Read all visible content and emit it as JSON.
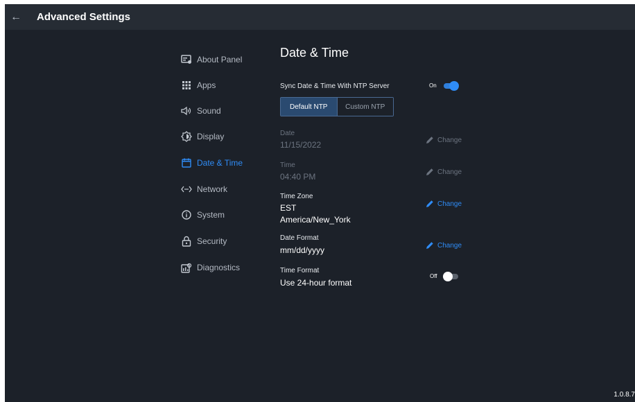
{
  "header": {
    "title": "Advanced Settings",
    "back_icon": "back-arrow-icon"
  },
  "sidebar": {
    "items": [
      {
        "label": "About Panel",
        "icon": "about-panel-icon"
      },
      {
        "label": "Apps",
        "icon": "apps-grid-icon"
      },
      {
        "label": "Sound",
        "icon": "speaker-icon"
      },
      {
        "label": "Display",
        "icon": "display-brightness-icon"
      },
      {
        "label": "Date & Time",
        "icon": "calendar-icon",
        "active": true
      },
      {
        "label": "Network",
        "icon": "network-code-icon"
      },
      {
        "label": "System",
        "icon": "info-icon"
      },
      {
        "label": "Security",
        "icon": "lock-icon"
      },
      {
        "label": "Diagnostics",
        "icon": "diagnostics-icon"
      }
    ]
  },
  "main": {
    "title": "Date & Time",
    "sync": {
      "label": "Sync Date & Time With NTP Server",
      "state": "On"
    },
    "ntp_tabs": {
      "default": "Default NTP",
      "custom": "Custom NTP",
      "selected": "default"
    },
    "date": {
      "label": "Date",
      "value": "11/15/2022",
      "action": "Change"
    },
    "time": {
      "label": "Time",
      "value": "04:40 PM",
      "action": "Change"
    },
    "timezone": {
      "label": "Time Zone",
      "abbr": "EST",
      "region": "America/New_York",
      "action": "Change"
    },
    "date_format": {
      "label": "Date Format",
      "value": "mm/dd/yyyy",
      "action": "Change"
    },
    "time_format": {
      "label": "Time Format",
      "value": "Use 24-hour format",
      "state": "Off"
    }
  },
  "footer": {
    "version": "1.0.8.7"
  },
  "colors": {
    "accent": "#2f8cf6",
    "background": "#1c2129",
    "topbar": "#262c34",
    "muted": "#6c7480"
  }
}
